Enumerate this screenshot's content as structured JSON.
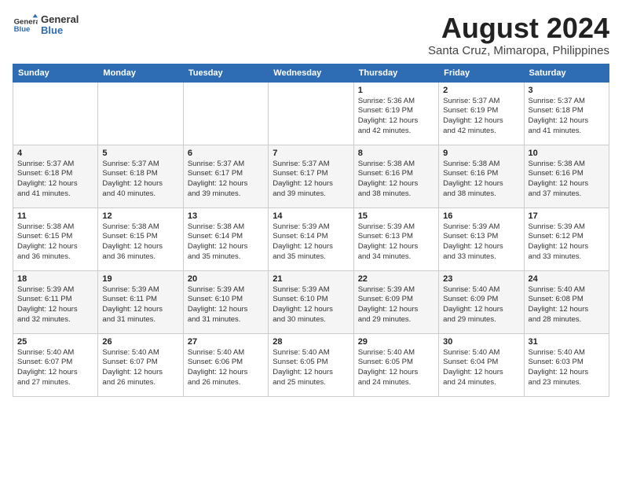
{
  "header": {
    "logo_line1": "General",
    "logo_line2": "Blue",
    "month_year": "August 2024",
    "location": "Santa Cruz, Mimaropa, Philippines"
  },
  "days_of_week": [
    "Sunday",
    "Monday",
    "Tuesday",
    "Wednesday",
    "Thursday",
    "Friday",
    "Saturday"
  ],
  "weeks": [
    [
      {
        "day": "",
        "info": ""
      },
      {
        "day": "",
        "info": ""
      },
      {
        "day": "",
        "info": ""
      },
      {
        "day": "",
        "info": ""
      },
      {
        "day": "1",
        "info": "Sunrise: 5:36 AM\nSunset: 6:19 PM\nDaylight: 12 hours\nand 42 minutes."
      },
      {
        "day": "2",
        "info": "Sunrise: 5:37 AM\nSunset: 6:19 PM\nDaylight: 12 hours\nand 42 minutes."
      },
      {
        "day": "3",
        "info": "Sunrise: 5:37 AM\nSunset: 6:18 PM\nDaylight: 12 hours\nand 41 minutes."
      }
    ],
    [
      {
        "day": "4",
        "info": "Sunrise: 5:37 AM\nSunset: 6:18 PM\nDaylight: 12 hours\nand 41 minutes."
      },
      {
        "day": "5",
        "info": "Sunrise: 5:37 AM\nSunset: 6:18 PM\nDaylight: 12 hours\nand 40 minutes."
      },
      {
        "day": "6",
        "info": "Sunrise: 5:37 AM\nSunset: 6:17 PM\nDaylight: 12 hours\nand 39 minutes."
      },
      {
        "day": "7",
        "info": "Sunrise: 5:37 AM\nSunset: 6:17 PM\nDaylight: 12 hours\nand 39 minutes."
      },
      {
        "day": "8",
        "info": "Sunrise: 5:38 AM\nSunset: 6:16 PM\nDaylight: 12 hours\nand 38 minutes."
      },
      {
        "day": "9",
        "info": "Sunrise: 5:38 AM\nSunset: 6:16 PM\nDaylight: 12 hours\nand 38 minutes."
      },
      {
        "day": "10",
        "info": "Sunrise: 5:38 AM\nSunset: 6:16 PM\nDaylight: 12 hours\nand 37 minutes."
      }
    ],
    [
      {
        "day": "11",
        "info": "Sunrise: 5:38 AM\nSunset: 6:15 PM\nDaylight: 12 hours\nand 36 minutes."
      },
      {
        "day": "12",
        "info": "Sunrise: 5:38 AM\nSunset: 6:15 PM\nDaylight: 12 hours\nand 36 minutes."
      },
      {
        "day": "13",
        "info": "Sunrise: 5:38 AM\nSunset: 6:14 PM\nDaylight: 12 hours\nand 35 minutes."
      },
      {
        "day": "14",
        "info": "Sunrise: 5:39 AM\nSunset: 6:14 PM\nDaylight: 12 hours\nand 35 minutes."
      },
      {
        "day": "15",
        "info": "Sunrise: 5:39 AM\nSunset: 6:13 PM\nDaylight: 12 hours\nand 34 minutes."
      },
      {
        "day": "16",
        "info": "Sunrise: 5:39 AM\nSunset: 6:13 PM\nDaylight: 12 hours\nand 33 minutes."
      },
      {
        "day": "17",
        "info": "Sunrise: 5:39 AM\nSunset: 6:12 PM\nDaylight: 12 hours\nand 33 minutes."
      }
    ],
    [
      {
        "day": "18",
        "info": "Sunrise: 5:39 AM\nSunset: 6:11 PM\nDaylight: 12 hours\nand 32 minutes."
      },
      {
        "day": "19",
        "info": "Sunrise: 5:39 AM\nSunset: 6:11 PM\nDaylight: 12 hours\nand 31 minutes."
      },
      {
        "day": "20",
        "info": "Sunrise: 5:39 AM\nSunset: 6:10 PM\nDaylight: 12 hours\nand 31 minutes."
      },
      {
        "day": "21",
        "info": "Sunrise: 5:39 AM\nSunset: 6:10 PM\nDaylight: 12 hours\nand 30 minutes."
      },
      {
        "day": "22",
        "info": "Sunrise: 5:39 AM\nSunset: 6:09 PM\nDaylight: 12 hours\nand 29 minutes."
      },
      {
        "day": "23",
        "info": "Sunrise: 5:40 AM\nSunset: 6:09 PM\nDaylight: 12 hours\nand 29 minutes."
      },
      {
        "day": "24",
        "info": "Sunrise: 5:40 AM\nSunset: 6:08 PM\nDaylight: 12 hours\nand 28 minutes."
      }
    ],
    [
      {
        "day": "25",
        "info": "Sunrise: 5:40 AM\nSunset: 6:07 PM\nDaylight: 12 hours\nand 27 minutes."
      },
      {
        "day": "26",
        "info": "Sunrise: 5:40 AM\nSunset: 6:07 PM\nDaylight: 12 hours\nand 26 minutes."
      },
      {
        "day": "27",
        "info": "Sunrise: 5:40 AM\nSunset: 6:06 PM\nDaylight: 12 hours\nand 26 minutes."
      },
      {
        "day": "28",
        "info": "Sunrise: 5:40 AM\nSunset: 6:05 PM\nDaylight: 12 hours\nand 25 minutes."
      },
      {
        "day": "29",
        "info": "Sunrise: 5:40 AM\nSunset: 6:05 PM\nDaylight: 12 hours\nand 24 minutes."
      },
      {
        "day": "30",
        "info": "Sunrise: 5:40 AM\nSunset: 6:04 PM\nDaylight: 12 hours\nand 24 minutes."
      },
      {
        "day": "31",
        "info": "Sunrise: 5:40 AM\nSunset: 6:03 PM\nDaylight: 12 hours\nand 23 minutes."
      }
    ]
  ]
}
